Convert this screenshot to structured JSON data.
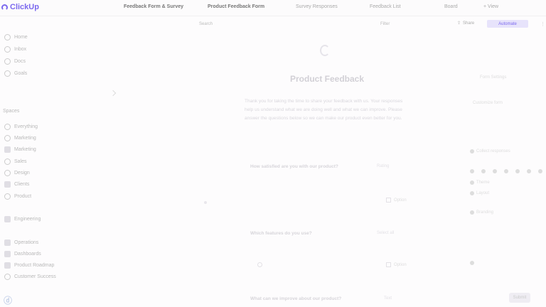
{
  "app": {
    "logo_text": "ClickUp",
    "colors": {
      "accent": "#7b68ee",
      "background": "#fdfcfd",
      "muted_text": "#d9d7dd"
    }
  },
  "topbar": {
    "tabs": [
      {
        "label": "Feedback Form & Survey",
        "icon": "doc-icon"
      },
      {
        "label": "Product Feedback Form"
      },
      {
        "label": "Survey Responses"
      },
      {
        "label": "Feedback List"
      },
      {
        "label": "Board"
      },
      {
        "label": "+ View"
      }
    ]
  },
  "sidebar": {
    "items": [
      {
        "label": "Home",
        "icon": "home-icon"
      },
      {
        "label": "Inbox",
        "icon": "inbox-icon"
      },
      {
        "label": "Docs",
        "icon": "docs-icon"
      },
      {
        "label": "Goals",
        "icon": "goals-icon"
      }
    ],
    "section_label": "Spaces",
    "spaces": [
      {
        "label": "Everything",
        "icon": "grid-icon"
      },
      {
        "label": "Marketing",
        "icon": "space-icon"
      },
      {
        "label": "Marketing",
        "icon": "space-icon"
      },
      {
        "label": "Sales",
        "icon": "list-icon"
      },
      {
        "label": "Design",
        "icon": "space-icon"
      },
      {
        "label": "Clients",
        "icon": "space-icon"
      },
      {
        "label": "Product",
        "icon": "space-icon"
      },
      {
        "label": "Engineering",
        "icon": "space-icon"
      },
      {
        "label": "Operations",
        "icon": "space-icon"
      },
      {
        "label": "Dashboards",
        "icon": "dashboard-icon"
      },
      {
        "label": "Product Roadmap",
        "icon": "roadmap-icon"
      },
      {
        "label": "Customer Success",
        "icon": "users-icon"
      }
    ]
  },
  "toolbar": {
    "search": "Search",
    "filter": "Filter",
    "share_label": "Share",
    "automate_label": "Automate"
  },
  "form": {
    "title": "Product Feedback",
    "description": "Thank you for taking the time to share your feedback with us. Your responses help us understand what we are doing well and what we can improve. Please answer the questions below so we can make our product even better for you.",
    "fields": [
      {
        "label": "How satisfied are you with our product?",
        "hint": "Rating"
      },
      {
        "label": "Which features do you use?",
        "hint": "Select all"
      },
      {
        "label": "What can we improve about our product?",
        "hint": "Text"
      }
    ],
    "option_label": "Option",
    "submit_label": "Submit"
  },
  "right_panel": {
    "heading": "Form Settings",
    "subheading": "Customize form",
    "items": [
      "Collect responses",
      "Theme",
      "Layout",
      "Branding"
    ]
  }
}
